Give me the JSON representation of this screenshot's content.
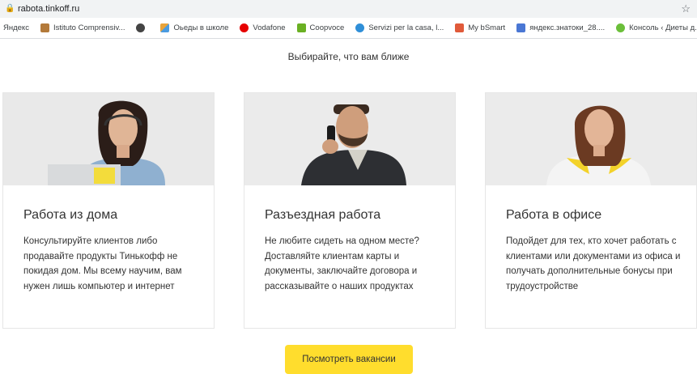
{
  "browser": {
    "url": "rabota.tinkoff.ru",
    "bookmarks": [
      {
        "label": "Яндекс",
        "color": ""
      },
      {
        "label": "Istituto Comprensiv...",
        "color": "#b37a3a"
      },
      {
        "label": "",
        "color": "#444444"
      },
      {
        "label": "Оьеды в школе",
        "color": "#e8a33a"
      },
      {
        "label": "Vodafone",
        "color": "#e60000"
      },
      {
        "label": "Coopvoce",
        "color": "#6ab023"
      },
      {
        "label": "Servizi per la casa, l...",
        "color": "#2f8fd8"
      },
      {
        "label": "My bSmart",
        "color": "#e05a3a"
      },
      {
        "label": "яндекс.знатоки_28....",
        "color": "#4a77d4"
      },
      {
        "label": "Консоль ‹ Диеты д...",
        "color": "#6bbf3a"
      }
    ]
  },
  "page": {
    "subtitle": "Выбирайте, что вам ближе",
    "cards": [
      {
        "title": "Работа из дома",
        "text": "Консультируйте клиентов либо продавайте продукты Тинькофф не покидая дом. Мы всему научим, вам нужен лишь компьютер и интернет"
      },
      {
        "title": "Разъездная работа",
        "text": "Не любите сидеть на одном месте? Доставляйте клиентам карты и документы, заключайте договора и рассказывайте о наших продуктах"
      },
      {
        "title": "Работа в офисе",
        "text": "Подойдет для тех, кто хочет работать с клиентами или документами из офиса и получать дополнительные бонусы при трудоустройстве"
      }
    ],
    "button": "Посмотреть вакансии",
    "accent": "#ffdd2d"
  }
}
